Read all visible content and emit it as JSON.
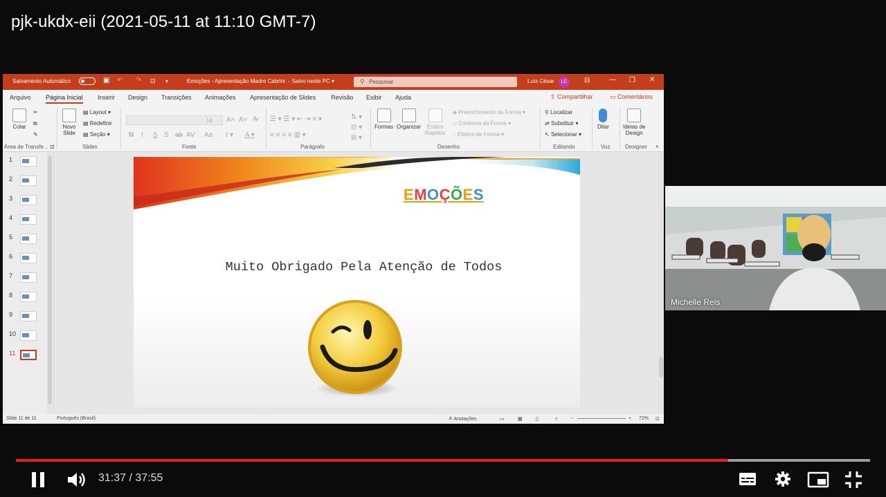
{
  "video": {
    "title": "pjk-ukdx-eii (2021-05-11 at 11:10 GMT-7)",
    "current_time": "31:37",
    "separator": "/",
    "duration": "37:55",
    "progress": 0.834,
    "buffered": 1.0
  },
  "ppt": {
    "titlebar": {
      "autosave_label": "Salvamento Automático",
      "doc_title": "Emoções - Apresentação Madre Cabrini",
      "saved_status": "Salvo neste PC",
      "search_placeholder": "Pesquisar",
      "user_name": "Luís César",
      "user_initials": "LC"
    },
    "menu_tabs": [
      "Arquivo",
      "Página Inicial",
      "Inserir",
      "Design",
      "Transições",
      "Animações",
      "Apresentação de Slides",
      "Revisão",
      "Exibir",
      "Ajuda"
    ],
    "share_label": "Compartilhar",
    "comments_label": "Comentários",
    "ribbon": {
      "groups": {
        "clipboard": "Área de Transfe...",
        "slides": "Slides",
        "font": "Fonte",
        "paragraph": "Parágrafo",
        "drawing": "Desenho",
        "editing": "Editando",
        "voice": "Voz",
        "designer": "Designer"
      },
      "paste": "Colar",
      "new_slide_1": "Novo",
      "new_slide_2": "Slide",
      "layout": "Layout",
      "reset": "Redefinir",
      "section": "Seção",
      "font_size": "14",
      "bold": "N",
      "italic": "I",
      "underline": "S",
      "strike": "S",
      "shapes": "Formas",
      "arrange": "Organizar",
      "quick_styles_1": "Estilos",
      "quick_styles_2": "Rápidos",
      "shape_fill": "Preenchimento da Forma",
      "shape_outline": "Contorno da Forma",
      "shape_effects": "Efeitos de Forma",
      "find": "Localizar",
      "replace": "Substituir",
      "select": "Selecionar",
      "dictate": "Ditar",
      "design_ideas_1": "Ideias de",
      "design_ideas_2": "Design"
    },
    "thumbnails": [
      "1",
      "2",
      "3",
      "4",
      "5",
      "6",
      "7",
      "8",
      "9",
      "10",
      "11"
    ],
    "active_slide": 11,
    "slide": {
      "title_letters": [
        "E",
        "M",
        "O",
        "Ç",
        "Õ",
        "E",
        "S"
      ],
      "title_colors": [
        "#e8a000",
        "#e8413a",
        "#3a8fd8",
        "#e8413a",
        "#2fae4e",
        "#e8a000",
        "#3a8fd8"
      ],
      "message": "Muito Obrigado Pela Atenção de Todos"
    },
    "status": {
      "slide_counter": "Slide 11 de 11",
      "language": "Português (Brasil)",
      "notes": "Anotações",
      "zoom": "72%"
    }
  },
  "webcam": {
    "participant_name": "Michelle Reis"
  },
  "icons": {
    "pause": "pause-icon",
    "volume": "volume-icon",
    "subtitles": "subtitles-icon",
    "settings": "gear-icon",
    "miniplayer": "miniplayer-icon",
    "fullscreen_exit": "exit-fullscreen-icon"
  },
  "colors": {
    "ppt_accent": "#c43e1c",
    "progress_red": "#e61e16"
  }
}
